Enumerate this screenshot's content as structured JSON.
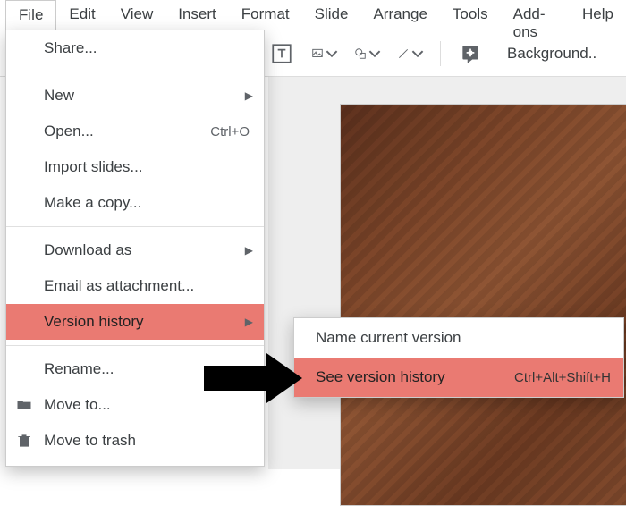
{
  "menubar": {
    "items": [
      "File",
      "Edit",
      "View",
      "Insert",
      "Format",
      "Slide",
      "Arrange",
      "Tools",
      "Add-ons",
      "Help"
    ]
  },
  "toolbar": {
    "backgroundLabel": "Background.."
  },
  "fileMenu": {
    "share": "Share...",
    "new": "New",
    "open": "Open...",
    "openShortcut": "Ctrl+O",
    "importSlides": "Import slides...",
    "makeCopy": "Make a copy...",
    "downloadAs": "Download as",
    "emailAttachment": "Email as attachment...",
    "versionHistory": "Version history",
    "rename": "Rename...",
    "moveTo": "Move to...",
    "moveToTrash": "Move to trash"
  },
  "submenu": {
    "nameCurrent": "Name current version",
    "seeHistory": "See version history",
    "seeHistoryShortcut": "Ctrl+Alt+Shift+H"
  }
}
